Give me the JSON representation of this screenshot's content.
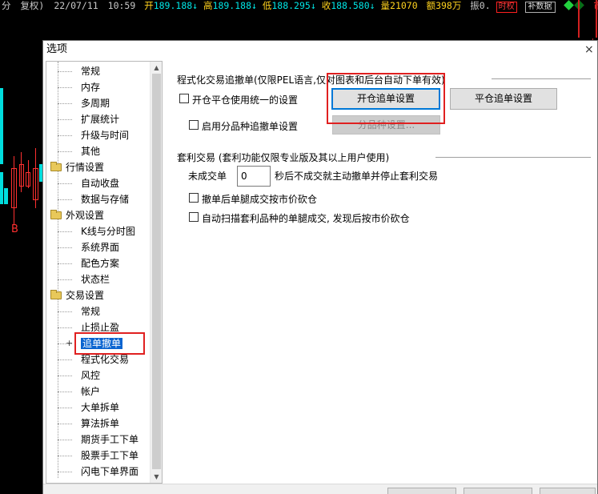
{
  "ticker": {
    "period": "分",
    "mode": "复权)",
    "date": "22/07/11",
    "time": "10:59",
    "open_label": "开",
    "open_value": "189.188↓",
    "high_label": "高",
    "high_value": "189.188↓",
    "low_label": "低",
    "low_value": "188.295↓",
    "close_label": "收",
    "close_value": "188.580↓",
    "volume_label": "量",
    "volume_value": "21070",
    "amount_label": "额",
    "amount_value": "398万",
    "amp_label": "振0.",
    "box1": "时权",
    "box2": "补数据",
    "corner": "市"
  },
  "background": {
    "chart_marker": "B"
  },
  "dialog": {
    "title": "选项",
    "close": "×"
  },
  "tree": {
    "items": [
      {
        "label": "常规",
        "type": "child"
      },
      {
        "label": "内存",
        "type": "child"
      },
      {
        "label": "多周期",
        "type": "child"
      },
      {
        "label": "扩展统计",
        "type": "child"
      },
      {
        "label": "升级与时间",
        "type": "child"
      },
      {
        "label": "其他",
        "type": "child"
      },
      {
        "label": "行情设置",
        "type": "group"
      },
      {
        "label": "自动收盘",
        "type": "child"
      },
      {
        "label": "数据与存储",
        "type": "child"
      },
      {
        "label": "外观设置",
        "type": "group"
      },
      {
        "label": "K线与分时图",
        "type": "child"
      },
      {
        "label": "系统界面",
        "type": "child"
      },
      {
        "label": "配色方案",
        "type": "child"
      },
      {
        "label": "状态栏",
        "type": "child"
      },
      {
        "label": "交易设置",
        "type": "group"
      },
      {
        "label": "常规",
        "type": "child"
      },
      {
        "label": "止损止盈",
        "type": "child"
      },
      {
        "label": "追单撤单",
        "type": "selected"
      },
      {
        "label": "程式化交易",
        "type": "child"
      },
      {
        "label": "风控",
        "type": "child"
      },
      {
        "label": "帐户",
        "type": "child"
      },
      {
        "label": "大单拆单",
        "type": "child"
      },
      {
        "label": "算法拆单",
        "type": "child"
      },
      {
        "label": "期货手工下单",
        "type": "child"
      },
      {
        "label": "股票手工下单",
        "type": "child"
      },
      {
        "label": "闪电下单界面",
        "type": "child"
      }
    ]
  },
  "program_section": {
    "title": "程式化交易追撤单(仅限PEL语言,仅对图表和后台自动下单有效)",
    "unified_checkbox_label": "开仓平仓使用统一的设置",
    "unified_checked": false,
    "open_button": "开仓追单设置",
    "close_button": "平仓追单设置",
    "variety_checkbox_label": "启用分品种追撤单设置",
    "variety_checked": false,
    "variety_button": "分品种设置..."
  },
  "arb_section": {
    "title": "套利交易 (套利功能仅限专业版及其以上用户使用)",
    "unfilled_label": "未成交单",
    "unfilled_value": "0",
    "unfilled_suffix": "秒后不成交就主动撤单并停止套利交易",
    "cancel_checkbox_label": "撤单后单腿成交按市价砍仓",
    "cancel_checked": false,
    "auto_checkbox_label": "自动扫描套利品种的单腿成交, 发现后按市价砍仓",
    "auto_checked": false
  },
  "colors": {
    "highlight_box": "#e02020",
    "selected_bg": "#0a64d0",
    "focus_border": "#0078d7"
  }
}
